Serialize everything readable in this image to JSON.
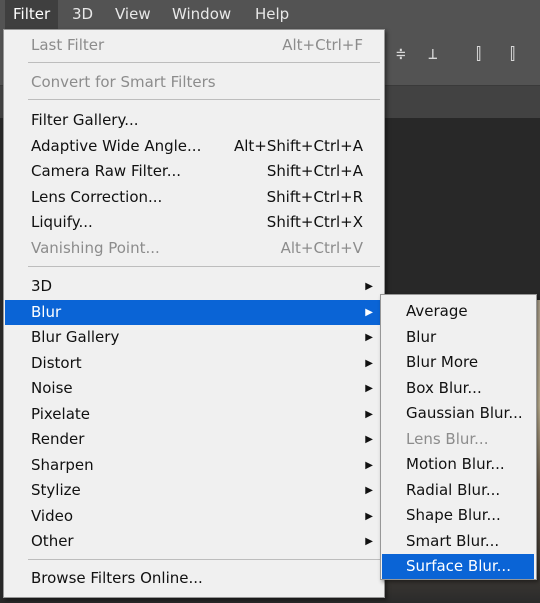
{
  "menubar": {
    "items": [
      "Filter",
      "3D",
      "View",
      "Window",
      "Help"
    ]
  },
  "filter_menu": {
    "last_filter": {
      "label": "Last Filter",
      "shortcut": "Alt+Ctrl+F"
    },
    "convert_smart": {
      "label": "Convert for Smart Filters"
    },
    "filter_gallery": {
      "label": "Filter Gallery..."
    },
    "adaptive_wide_angle": {
      "label": "Adaptive Wide Angle...",
      "shortcut": "Alt+Shift+Ctrl+A"
    },
    "camera_raw": {
      "label": "Camera Raw Filter...",
      "shortcut": "Shift+Ctrl+A"
    },
    "lens_correction": {
      "label": "Lens Correction...",
      "shortcut": "Shift+Ctrl+R"
    },
    "liquify": {
      "label": "Liquify...",
      "shortcut": "Shift+Ctrl+X"
    },
    "vanishing_point": {
      "label": "Vanishing Point...",
      "shortcut": "Alt+Ctrl+V"
    },
    "submenus": [
      "3D",
      "Blur",
      "Blur Gallery",
      "Distort",
      "Noise",
      "Pixelate",
      "Render",
      "Sharpen",
      "Stylize",
      "Video",
      "Other"
    ],
    "browse_online": {
      "label": "Browse Filters Online..."
    }
  },
  "blur_submenu": {
    "items": [
      "Average",
      "Blur",
      "Blur More",
      "Box Blur...",
      "Gaussian Blur...",
      "Lens Blur...",
      "Motion Blur...",
      "Radial Blur...",
      "Shape Blur...",
      "Smart Blur...",
      "Surface Blur..."
    ]
  },
  "colors": {
    "highlight": "#0a64d6",
    "menu_bg": "#f0f0f0",
    "menubar_bg": "#535353"
  }
}
